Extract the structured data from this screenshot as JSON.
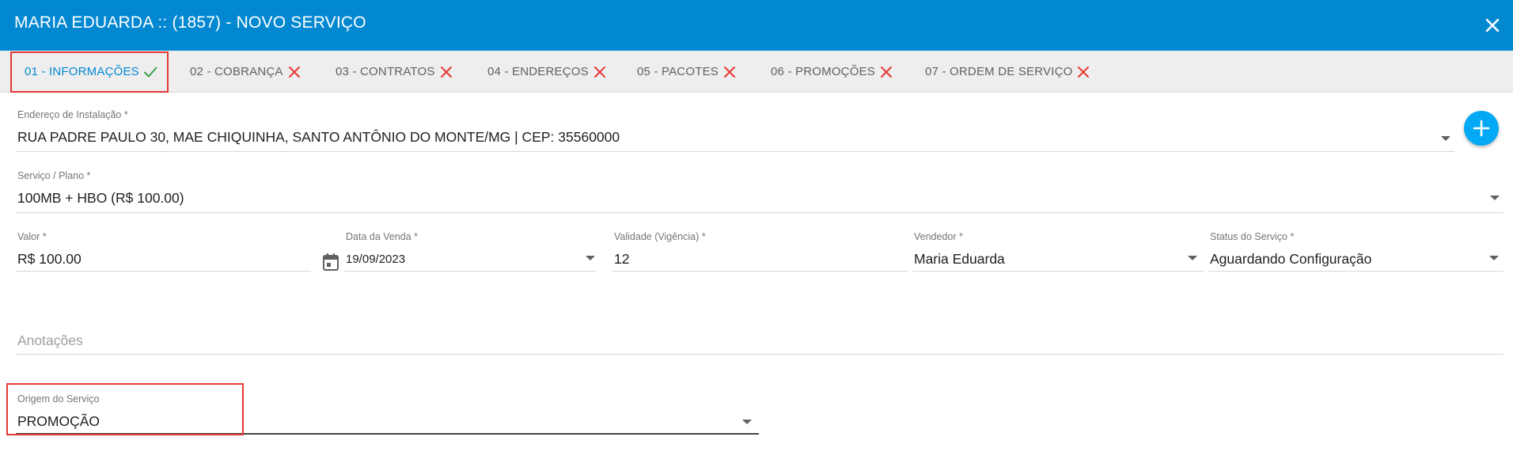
{
  "header": {
    "title": "MARIA EDUARDA :: (1857) - NOVO SERVIÇO",
    "close_icon": "close-icon"
  },
  "tabs": [
    {
      "label": "01 - INFORMAÇÕES",
      "status": "complete",
      "status_icon": "check-icon",
      "active": true
    },
    {
      "label": "02 - COBRANÇA",
      "status": "incomplete",
      "status_icon": "x-icon"
    },
    {
      "label": "03 - CONTRATOS",
      "status": "incomplete",
      "status_icon": "x-icon"
    },
    {
      "label": "04 - ENDEREÇOS",
      "status": "incomplete",
      "status_icon": "x-icon"
    },
    {
      "label": "05 - PACOTES",
      "status": "incomplete",
      "status_icon": "x-icon"
    },
    {
      "label": "06 - PROMOÇÕES",
      "status": "incomplete",
      "status_icon": "x-icon"
    },
    {
      "label": "07 - ORDEM DE SERVIÇO",
      "status": "incomplete",
      "status_icon": "x-icon"
    }
  ],
  "form": {
    "endereco": {
      "label": "Endereço de Instalação *",
      "value": "RUA PADRE PAULO 30, MAE CHIQUINHA, SANTO ANTÔNIO DO MONTE/MG | CEP: 35560000"
    },
    "servico": {
      "label": "Serviço / Plano *",
      "value": "100MB + HBO (R$ 100.00)"
    },
    "valor": {
      "label": "Valor *",
      "value": "R$ 100.00"
    },
    "data_venda": {
      "label": "Data da Venda *",
      "value": "19/09/2023",
      "icon": "calendar-icon"
    },
    "validade": {
      "label": "Validade (Vigência) *",
      "value": "12"
    },
    "vendedor": {
      "label": "Vendedor *",
      "value": "Maria Eduarda"
    },
    "status": {
      "label": "Status do Serviço *",
      "value": "Aguardando Configuração"
    },
    "anotacoes": {
      "placeholder": "Anotações"
    },
    "origem": {
      "label": "Origem do Serviço",
      "value": "PROMOÇÃO"
    }
  },
  "colors": {
    "header_bg": "#0288d1",
    "accent": "#0288d1",
    "fab": "#03a9f4",
    "success": "#43a047",
    "error": "#e53935",
    "highlight": "#e53935"
  }
}
